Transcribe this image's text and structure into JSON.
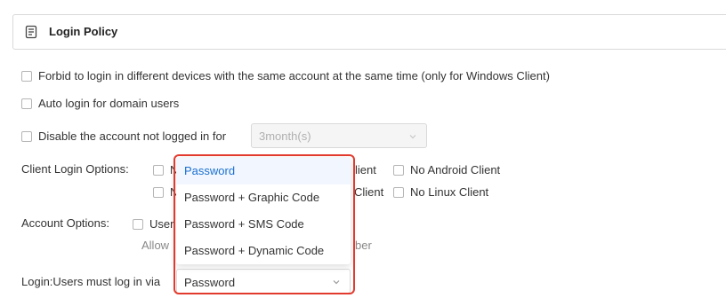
{
  "header": {
    "title": "Login Policy",
    "icon": "document-list-icon"
  },
  "options": {
    "forbid_multi_device": "Forbid to login in different devices with the same account at the same time (only for Windows Client)",
    "auto_login_domain": "Auto login for domain users",
    "disable_account": "Disable the account not logged in for",
    "disable_period": "3month(s)"
  },
  "client_login": {
    "label": "Client Login Options:",
    "row1_left_partial": "N",
    "row1_mid_partial": "lient",
    "row1_right": "No Android Client",
    "row2_left_partial": "N",
    "row2_mid_partial": "Client",
    "row2_right": "No Linux Client"
  },
  "account_options": {
    "label": "Account Options:",
    "option_partial": "User",
    "allow_partial": "Allow",
    "tail_partial": "ber"
  },
  "login_via": {
    "label": "Login:Users must log in via",
    "selected": "Password",
    "dropdown_items": [
      "Password",
      "Password + Graphic Code",
      "Password + SMS Code",
      "Password + Dynamic Code"
    ]
  },
  "colors": {
    "highlight": "#e23b2e",
    "selected_item": "#1a6fd1"
  }
}
